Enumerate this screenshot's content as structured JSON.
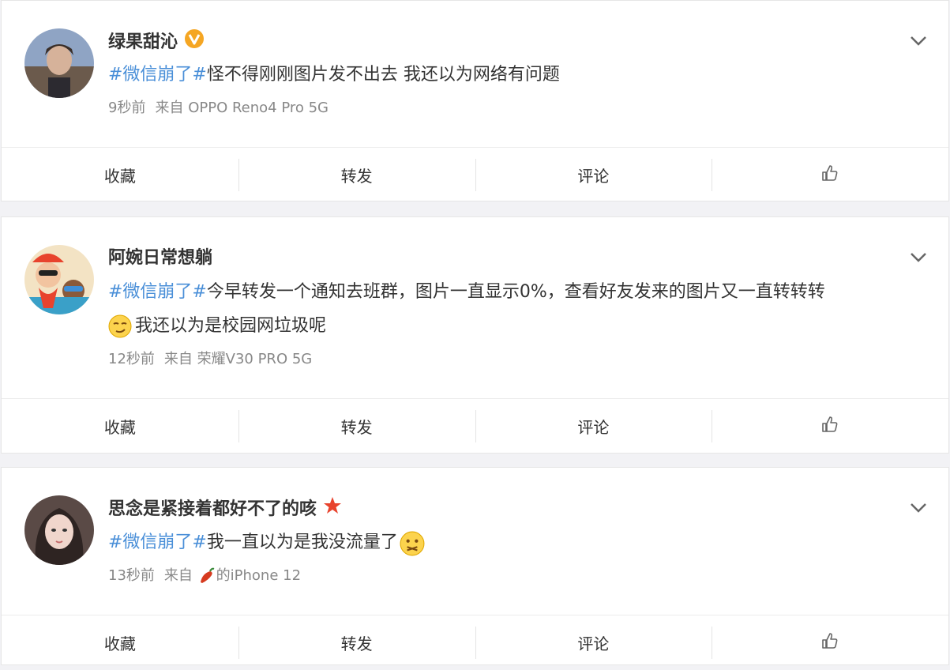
{
  "posts": [
    {
      "author": "绿果甜沁",
      "tag": "#微信崩了#",
      "text": "怪不得刚刚图片发不出去 我还以为网络有问题",
      "text2": "",
      "time": "9秒前",
      "source_prefix": "来自",
      "source": "OPPO Reno4 Pro 5G",
      "actions": {
        "fav": "收藏",
        "repost": "转发",
        "comment": "评论"
      }
    },
    {
      "author": "阿婉日常想躺",
      "tag": "#微信崩了#",
      "text": "今早转发一个通知去班群，图片一直显示0%，查看好友发来的图片又一直转转转",
      "text2": "我还以为是校园网垃圾呢",
      "time": "12秒前",
      "source_prefix": "来自",
      "source": "荣耀V30 PRO 5G",
      "actions": {
        "fav": "收藏",
        "repost": "转发",
        "comment": "评论"
      }
    },
    {
      "author": "思念是紧接着都好不了的咳",
      "tag": "#微信崩了#",
      "text": "我一直以为是我没流量了",
      "text2": "",
      "time": "13秒前",
      "source_prefix": "来自",
      "source": "的iPhone 12",
      "actions": {
        "fav": "收藏",
        "repost": "转发",
        "comment": "评论"
      }
    }
  ],
  "icons": {
    "verified": "verified-badge-icon",
    "expand": "chevron-down-icon",
    "like": "thumbs-up-icon",
    "star": "red-star-icon",
    "pepper": "chili-pepper-icon"
  },
  "colors": {
    "tag": "#4a8fd8",
    "verified": "#f5a623",
    "star": "#e8432d"
  }
}
